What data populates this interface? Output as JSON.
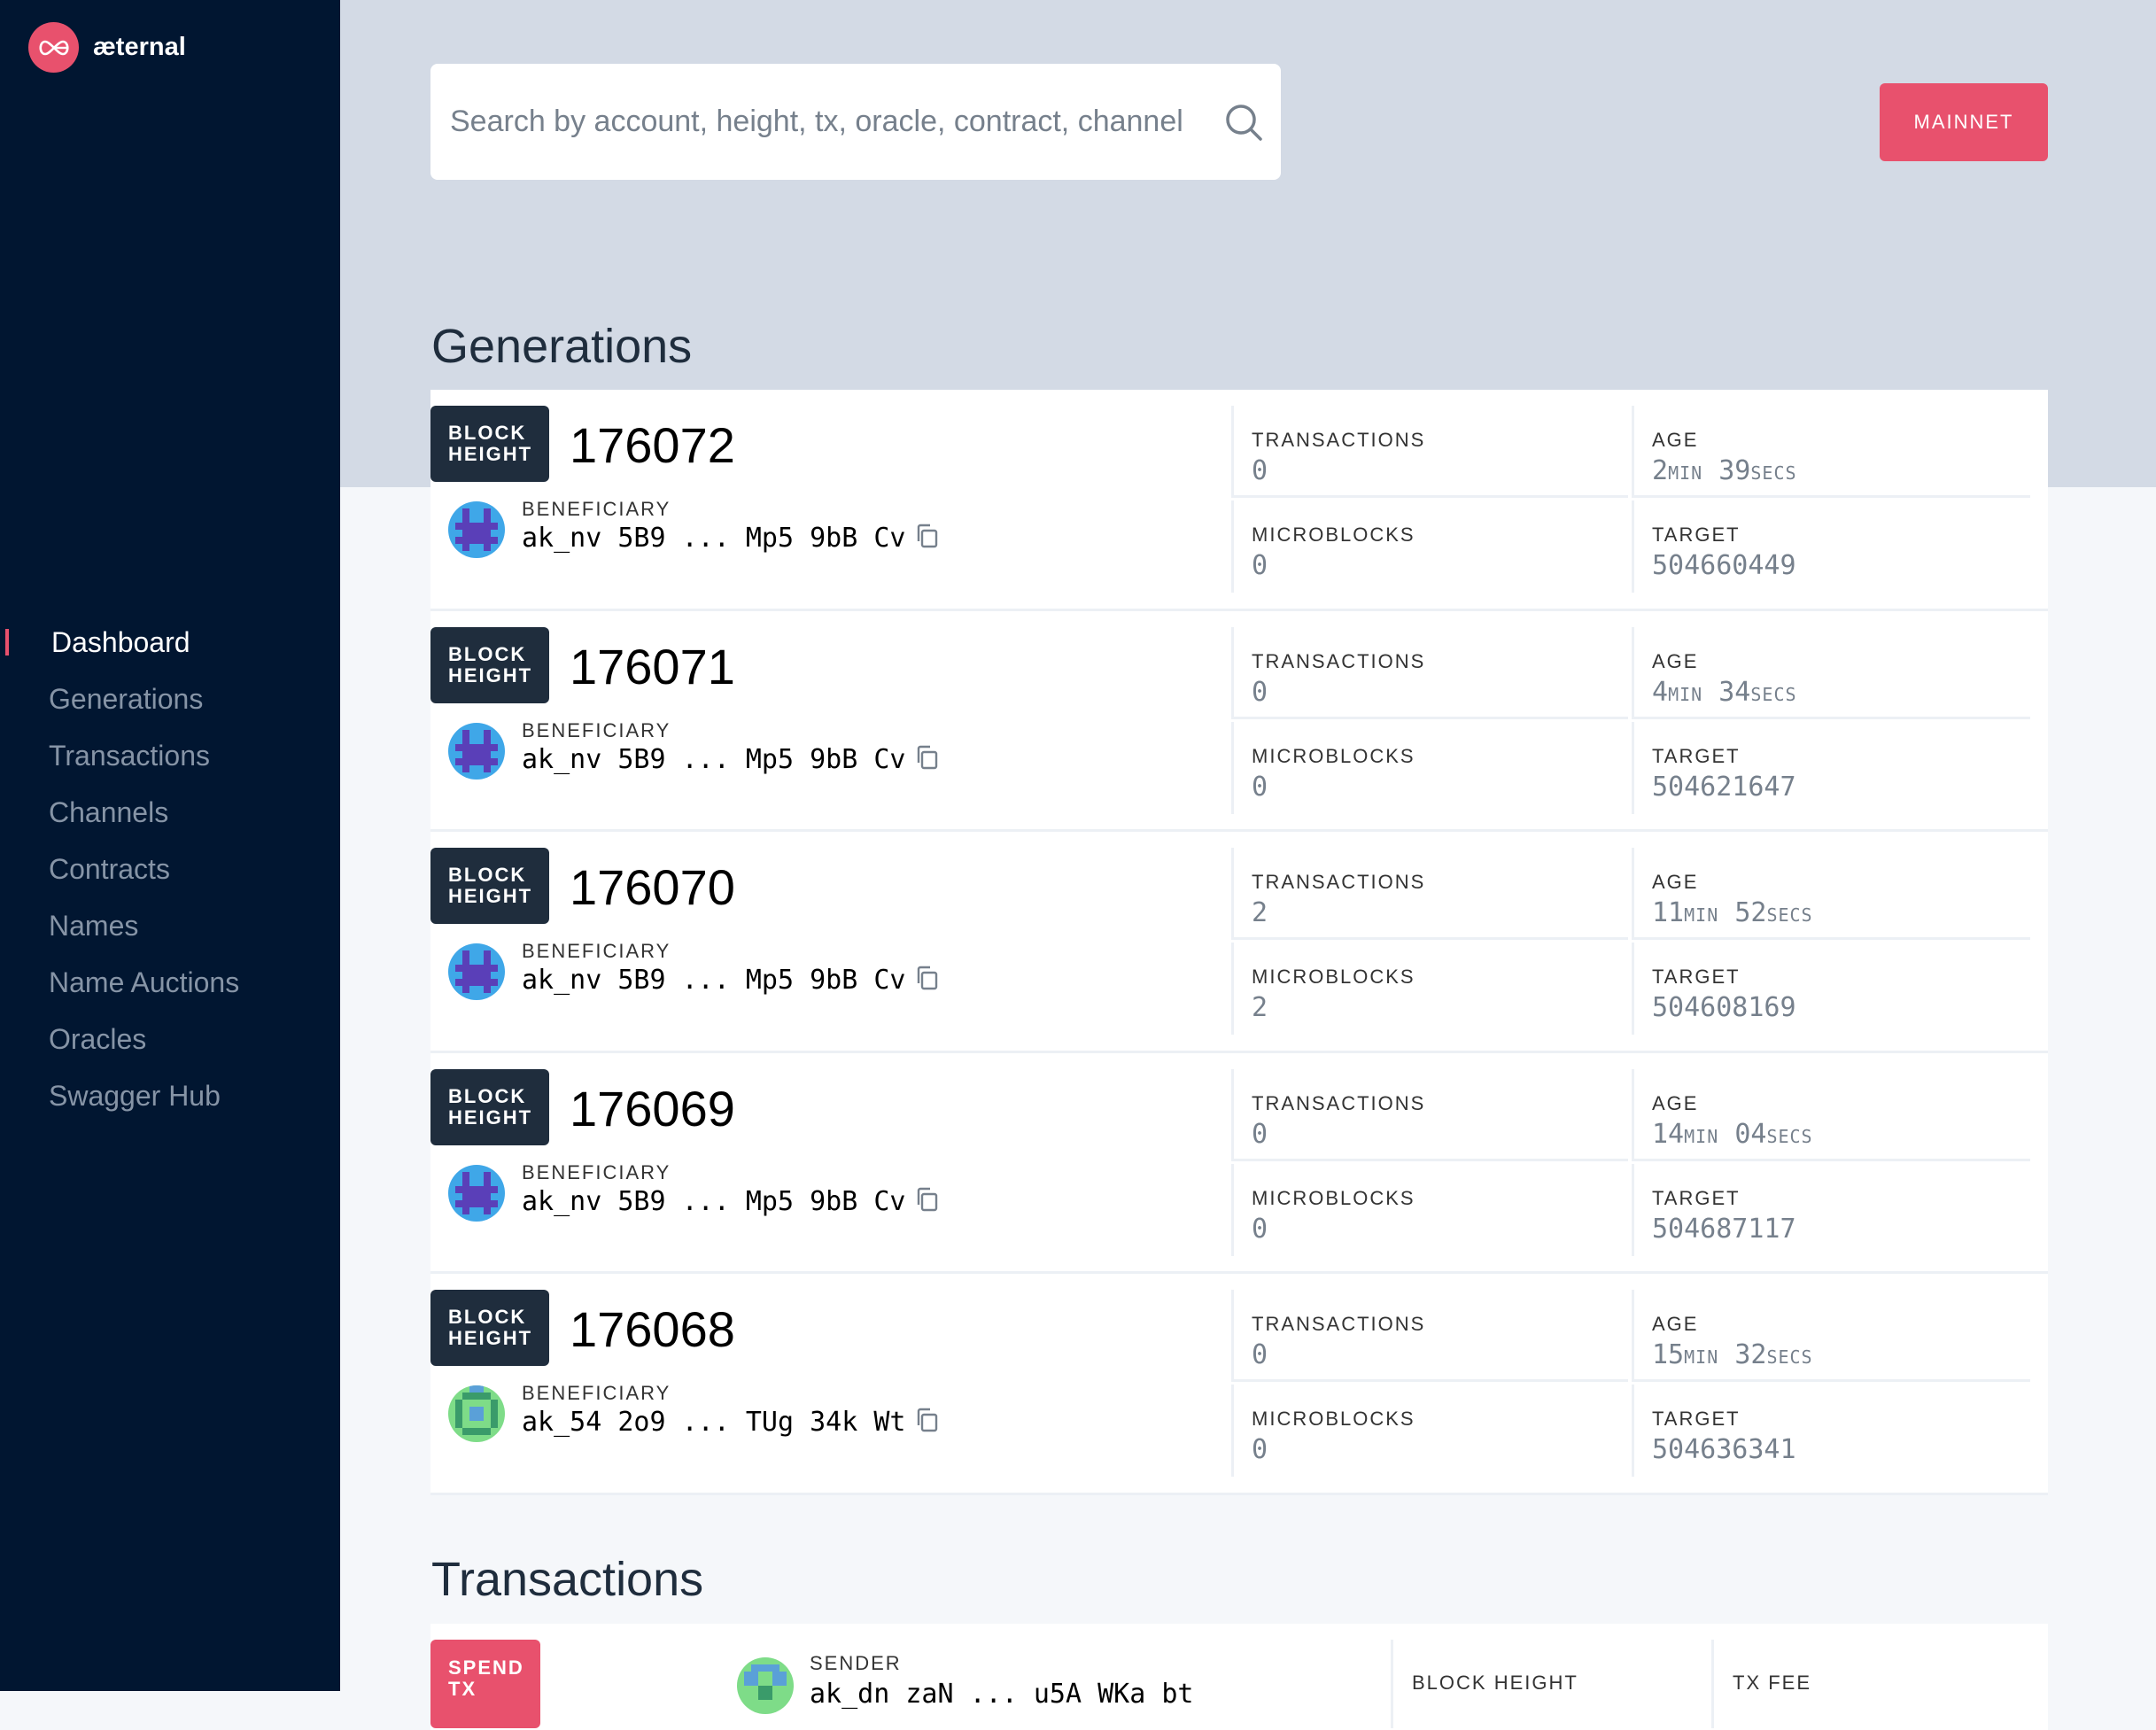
{
  "brand": {
    "name": "æternal",
    "accent": "#e8516d",
    "sidebar_bg": "#011631"
  },
  "sidebar": {
    "items": [
      {
        "label": "Dashboard",
        "active": true
      },
      {
        "label": "Generations"
      },
      {
        "label": "Transactions"
      },
      {
        "label": "Channels"
      },
      {
        "label": "Contracts"
      },
      {
        "label": "Names"
      },
      {
        "label": "Name Auctions"
      },
      {
        "label": "Oracles"
      },
      {
        "label": "Swagger Hub"
      }
    ]
  },
  "search": {
    "placeholder": "Search by account, height, tx, oracle, contract, channel",
    "icon": "search-icon"
  },
  "network": {
    "label": "MAINNET"
  },
  "generations": {
    "title": "Generations",
    "labels": {
      "badge_line1": "BLOCK",
      "badge_line2": "HEIGHT",
      "beneficiary": "BENEFICIARY",
      "transactions": "TRANSACTIONS",
      "microblocks": "MICROBLOCKS",
      "age": "AGE",
      "target": "TARGET",
      "min": "MIN",
      "secs": "SECS"
    },
    "rows": [
      {
        "height": "176072",
        "beneficiary": "ak_nv 5B9 ... Mp5 9bB Cv",
        "transactions": "0",
        "microblocks": "0",
        "age_min": "2",
        "age_secs": "39",
        "target": "504660449"
      },
      {
        "height": "176071",
        "beneficiary": "ak_nv 5B9 ... Mp5 9bB Cv",
        "transactions": "0",
        "microblocks": "0",
        "age_min": "4",
        "age_secs": "34",
        "target": "504621647"
      },
      {
        "height": "176070",
        "beneficiary": "ak_nv 5B9 ... Mp5 9bB Cv",
        "transactions": "2",
        "microblocks": "2",
        "age_min": "11",
        "age_secs": "52",
        "target": "504608169"
      },
      {
        "height": "176069",
        "beneficiary": "ak_nv 5B9 ... Mp5 9bB Cv",
        "transactions": "0",
        "microblocks": "0",
        "age_min": "14",
        "age_secs": "04",
        "target": "504687117"
      },
      {
        "height": "176068",
        "beneficiary": "ak_54 2o9 ... TUg 34k Wt",
        "transactions": "0",
        "microblocks": "0",
        "age_min": "15",
        "age_secs": "32",
        "target": "504636341"
      }
    ]
  },
  "transactions": {
    "title": "Transactions",
    "first": {
      "badge_line1": "SPEND",
      "badge_line2": "TX",
      "sender_label": "SENDER",
      "sender": "ak_dn zaN ... u5A WKa bt",
      "block_height_label": "BLOCK HEIGHT",
      "tx_fee_label": "TX FEE"
    }
  }
}
